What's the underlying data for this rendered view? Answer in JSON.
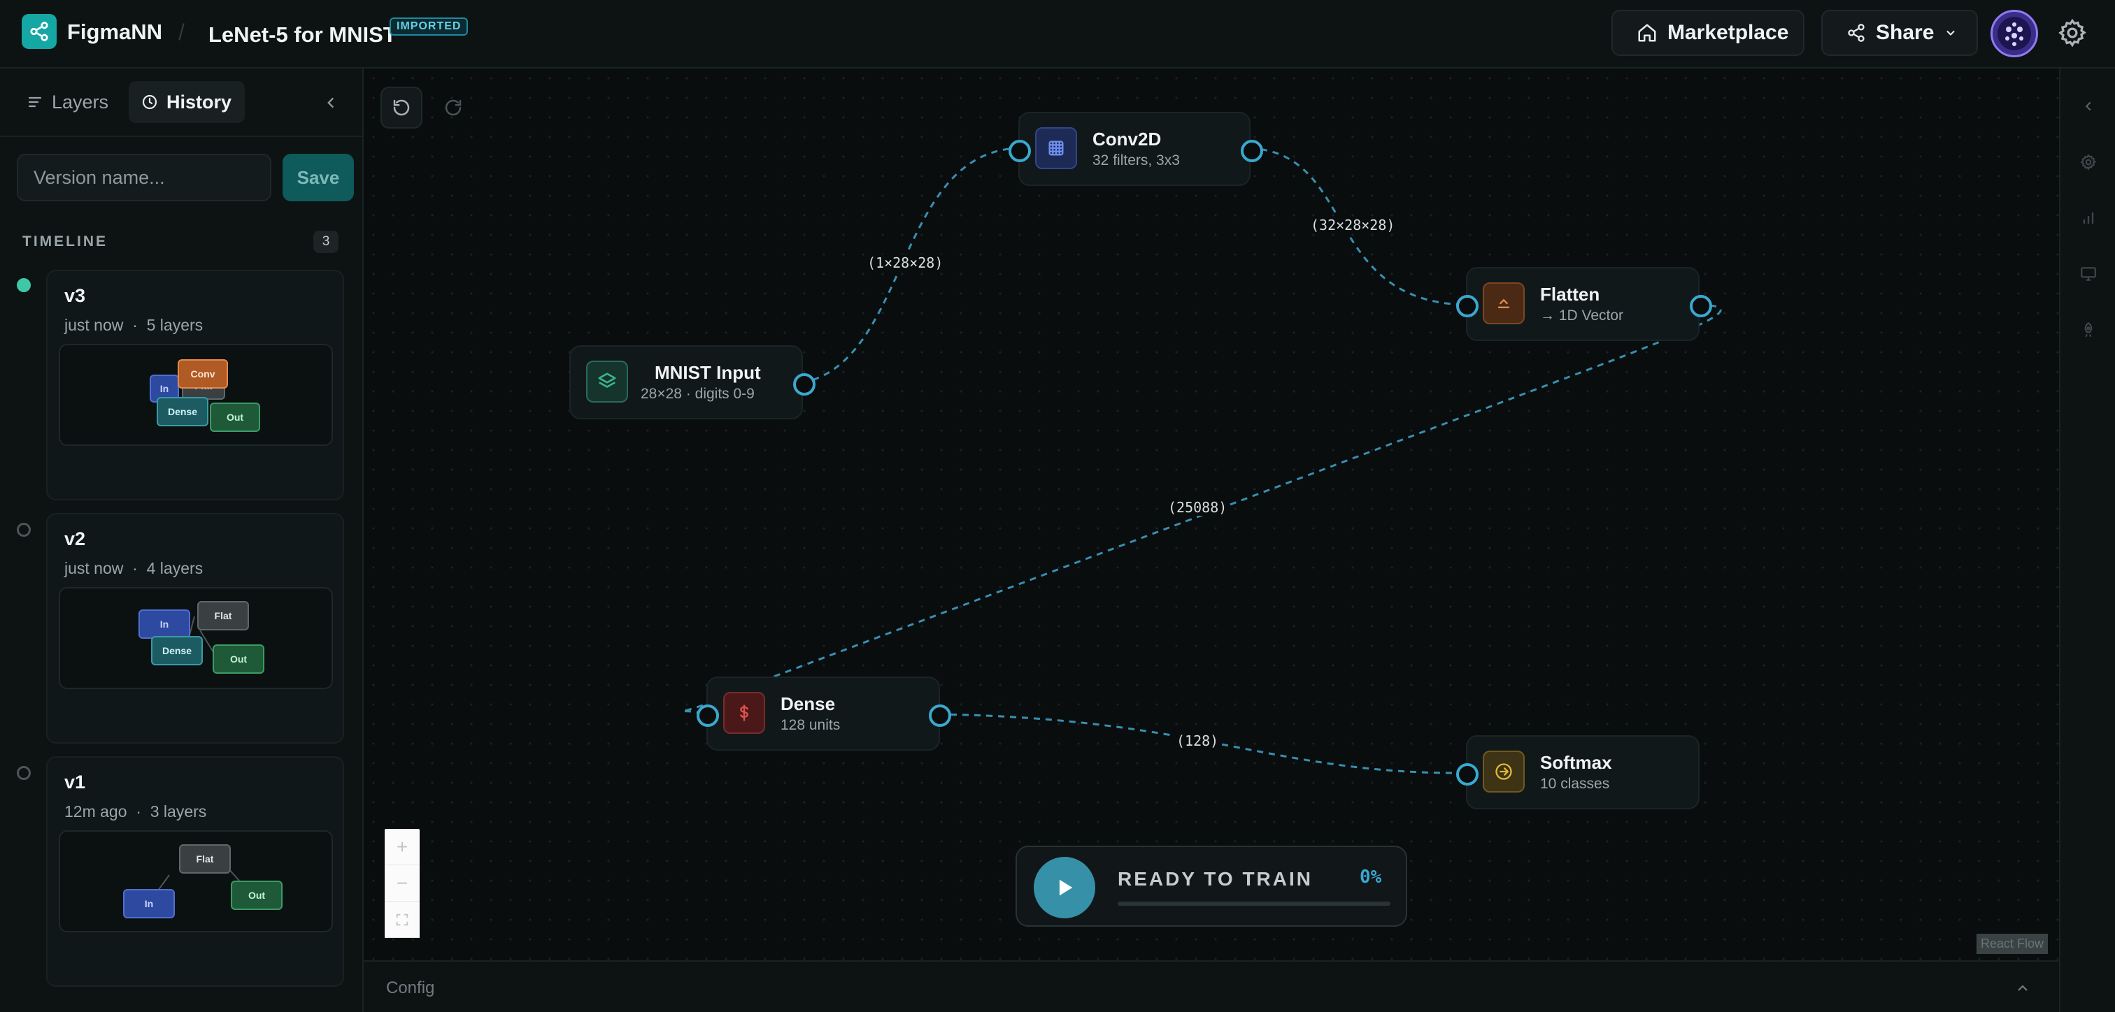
{
  "app": {
    "brand": "FigmaNN",
    "project": "LeNet-5 for MNIST",
    "badge": "IMPORTED"
  },
  "header": {
    "marketplace_label": "Marketplace",
    "share_label": "Share"
  },
  "sidebar": {
    "tabs": [
      {
        "label": "Layers"
      },
      {
        "label": "History"
      }
    ],
    "active_tab": "History",
    "version_input": {
      "placeholder": "Version name...",
      "value": ""
    },
    "save_label": "Save",
    "timeline_label": "TIMELINE",
    "timeline_count": "3",
    "versions": [
      {
        "name": "v3",
        "time": "just now",
        "layers": "5 layers",
        "active": true,
        "preview": [
          "In",
          "Conv",
          "Flat",
          "Dense",
          "Out"
        ]
      },
      {
        "name": "v2",
        "time": "just now",
        "layers": "4 layers",
        "active": false,
        "preview": [
          "In",
          "Flat",
          "Dense",
          "Out"
        ]
      },
      {
        "name": "v1",
        "time": "12m ago",
        "layers": "3 layers",
        "active": false,
        "preview": [
          "Flat",
          "In",
          "Out"
        ]
      }
    ]
  },
  "canvas": {
    "nodes": [
      {
        "id": "input",
        "title": "MNIST Input",
        "subtitle": "28×28 · digits 0-9",
        "icon": "layers-icon",
        "color": "#3fb58a"
      },
      {
        "id": "conv",
        "title": "Conv2D",
        "subtitle": "32 filters, 3x3",
        "icon": "grid-icon",
        "color": "#4f6fd0"
      },
      {
        "id": "flatten",
        "title": "Flatten",
        "subtitle": "→ 1D Vector",
        "icon": "flatten-icon",
        "color": "#e48a4a"
      },
      {
        "id": "dense",
        "title": "Dense",
        "subtitle": "128 units",
        "icon": "dollar-icon",
        "color": "#d84a4a"
      },
      {
        "id": "softmax",
        "title": "Softmax",
        "subtitle": "10 classes",
        "icon": "arrow-circle-icon",
        "color": "#d8b43a"
      }
    ],
    "edge_labels": [
      "(1×28×28)",
      "(32×28×28)",
      "(25088)",
      "(128)"
    ],
    "edge_color": "#3aa8cf",
    "train": {
      "status": "READY TO TRAIN",
      "percent": "0%",
      "progress": 0
    },
    "attribution": "React Flow",
    "config_label": "Config"
  },
  "colors": {
    "accent": "#15a7a4",
    "handle": "#3aa8cf",
    "active_dot": "#3fc8a8"
  }
}
